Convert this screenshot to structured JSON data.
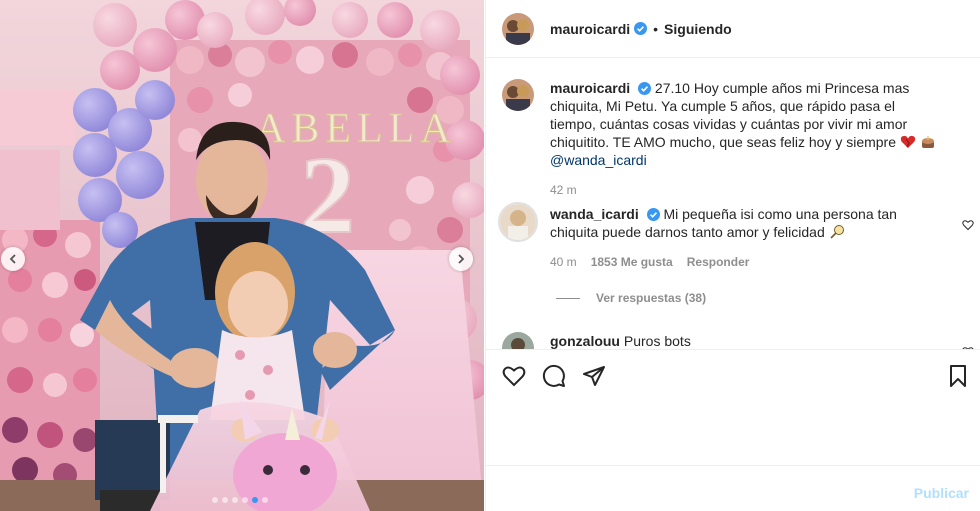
{
  "post": {
    "author": "mauroicardi",
    "follow_status": "Siguiendo",
    "separator": "•"
  },
  "caption": {
    "username": "mauroicardi",
    "text": "27.10 Hoy cumple años mi Princesa mas chiquita, Mi Petu. Ya cumple 5 años, que rápido pasa el tiempo, cuántas cosas vividas y cuántas por vivir mi amor chiquitito. TE AMO mucho, que seas feliz hoy y siempre",
    "mention": "@wanda_icardi",
    "time": "42 m"
  },
  "comments": [
    {
      "username": "wanda_icardi",
      "text": "Mi pequeña isi como una persona tan chiquita puede darnos tanto amor y felicidad",
      "time": "40 m",
      "likes": "1853 Me gusta",
      "reply_label": "Responder",
      "view_replies": "Ver respuestas (38)"
    },
    {
      "username": "gonzalouu",
      "text": "Puros bots"
    }
  ],
  "composer": {
    "post_label": "Publicar"
  },
  "photo": {
    "sign_text": "ABELLA",
    "number": "2"
  },
  "colors": {
    "link": "#00376b",
    "verified": "#3897f0",
    "post_disabled": "#b2dffc",
    "muted": "#8e8e8e"
  },
  "icons": [
    "heart-icon",
    "comment-icon",
    "share-icon",
    "bookmark-icon",
    "verified-badge-icon",
    "chevron-left-icon",
    "chevron-right-icon"
  ]
}
